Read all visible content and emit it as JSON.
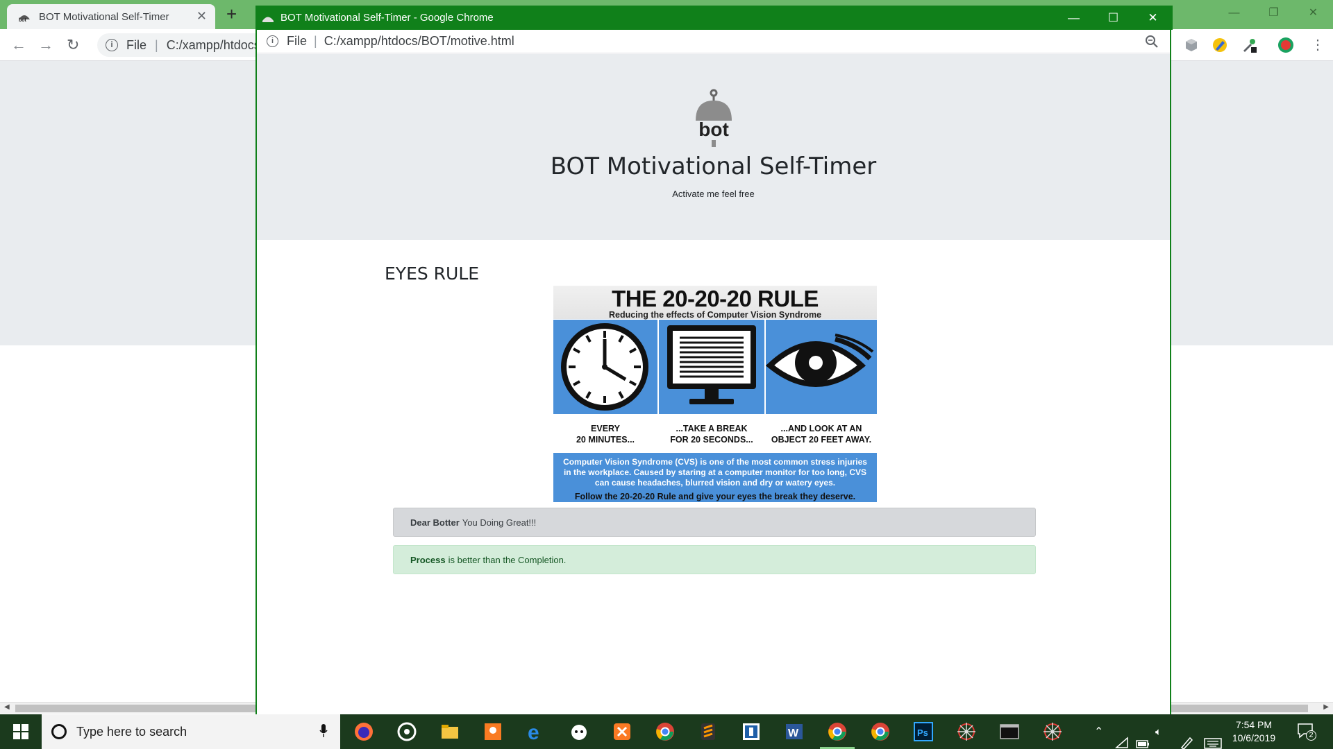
{
  "background_window": {
    "tab_title": "BOT Motivational Self-Timer",
    "tab_close": "✕",
    "new_tab": "+",
    "url_scheme": "File",
    "url": "C:/xampp/htdocs/BOT/motive.html",
    "controls": {
      "minimize": "—",
      "restore": "❐",
      "close": "✕"
    }
  },
  "popup_window": {
    "title": "BOT Motivational Self-Timer - Google Chrome",
    "url_scheme": "File",
    "url": "C:/xampp/htdocs/BOT/motive.html",
    "controls": {
      "minimize": "—",
      "maximize": "☐",
      "close": "✕"
    }
  },
  "page": {
    "logo_text": "bot",
    "title": "BOT Motivational Self-Timer",
    "tagline": "Activate me feel free",
    "section_title": "EYES RULE",
    "poster": {
      "title": "THE 20-20-20 RULE",
      "subtitle": "Reducing the effects of Computer Vision Syndrome",
      "captions": [
        {
          "line1": "EVERY",
          "line2": "20 MINUTES..."
        },
        {
          "line1": "...TAKE A BREAK",
          "line2": "FOR 20 SECONDS..."
        },
        {
          "line1": "...AND LOOK AT AN",
          "line2": "OBJECT 20 FEET AWAY."
        }
      ],
      "description": "Computer Vision Syndrome (CVS) is one of the most common stress injuries in the workplace. Caused by staring at a computer monitor for too long, CVS can cause headaches, blurred vision and dry or watery eyes.",
      "cta": "Follow the 20-20-20 Rule and give your eyes the break they deserve.",
      "panel_color": "#4a90d9"
    },
    "alerts": [
      {
        "strong": "Dear Botter",
        "text": "You Doing Great!!!"
      },
      {
        "strong": "Process",
        "text": "is better than the Completion."
      }
    ]
  },
  "taskbar": {
    "search_placeholder": "Type here to search",
    "apps": [
      "firefox-icon",
      "groove-music-icon",
      "file-explorer-icon",
      "sublime-app-icon",
      "edge-icon",
      "github-desktop-icon",
      "xampp-icon",
      "chrome-icon",
      "sublime-text-icon",
      "dictionary-icon",
      "word-icon",
      "chrome-active-icon",
      "chrome-2-icon",
      "photoshop-icon",
      "spider-app-icon",
      "terminal-icon",
      "spider-app-2-icon"
    ],
    "clock_time": "7:54 PM",
    "clock_date": "10/6/2019",
    "notification_count": "2"
  },
  "colors": {
    "popup_frame": "#10801a",
    "jumbotron": "#e9ecef",
    "alert_secondary": "#d6d8db",
    "alert_success": "#d4edda",
    "taskbar": "#1b3a1d"
  }
}
